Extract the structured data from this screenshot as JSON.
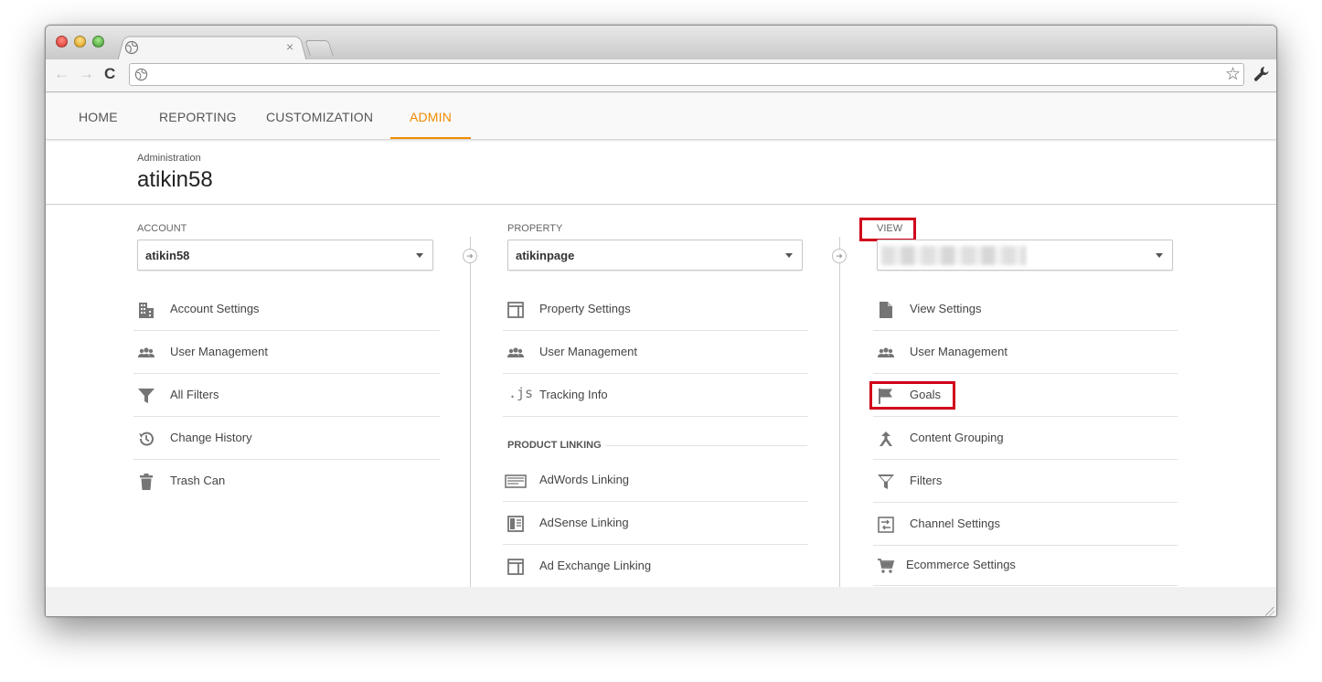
{
  "browser": {
    "tab_close": "×",
    "back_glyph": "←",
    "forward_glyph": "→",
    "reload_glyph": "C",
    "bookmark_glyph": "☆",
    "address": ""
  },
  "nav": {
    "items": [
      {
        "label": "HOME"
      },
      {
        "label": "REPORTING"
      },
      {
        "label": "CUSTOMIZATION"
      },
      {
        "label": "ADMIN",
        "active": true
      }
    ]
  },
  "header": {
    "label": "Administration",
    "title": "atikin58"
  },
  "account": {
    "label": "ACCOUNT",
    "selected": "atikin58",
    "items": [
      {
        "label": "Account Settings",
        "icon": "building-icon"
      },
      {
        "label": "User Management",
        "icon": "users-icon"
      },
      {
        "label": "All Filters",
        "icon": "filter-icon"
      },
      {
        "label": "Change History",
        "icon": "history-icon"
      },
      {
        "label": "Trash Can",
        "icon": "trash-icon"
      }
    ]
  },
  "property": {
    "label": "PROPERTY",
    "selected": "atikinpage",
    "items": [
      {
        "label": "Property Settings",
        "icon": "layout-icon"
      },
      {
        "label": "User Management",
        "icon": "users-icon"
      },
      {
        "label": "Tracking Info",
        "icon": "js-icon",
        "icon_text": ".js"
      }
    ],
    "linking_header": "PRODUCT LINKING",
    "linking_items": [
      {
        "label": "AdWords Linking",
        "icon": "adwords-icon"
      },
      {
        "label": "AdSense Linking",
        "icon": "adsense-icon"
      },
      {
        "label": "Ad Exchange Linking",
        "icon": "layout-icon"
      }
    ]
  },
  "view": {
    "label": "VIEW",
    "selected": "",
    "items": [
      {
        "label": "View Settings",
        "icon": "document-icon"
      },
      {
        "label": "User Management",
        "icon": "users-icon"
      },
      {
        "label": "Goals",
        "icon": "flag-icon"
      },
      {
        "label": "Content Grouping",
        "icon": "grouping-icon"
      },
      {
        "label": "Filters",
        "icon": "filter-icon"
      },
      {
        "label": "Channel Settings",
        "icon": "channel-icon"
      },
      {
        "label": "Ecommerce Settings",
        "icon": "cart-icon"
      }
    ]
  },
  "colors": {
    "accent": "#f18b00",
    "highlight": "#d0021b",
    "icon": "#757575"
  }
}
